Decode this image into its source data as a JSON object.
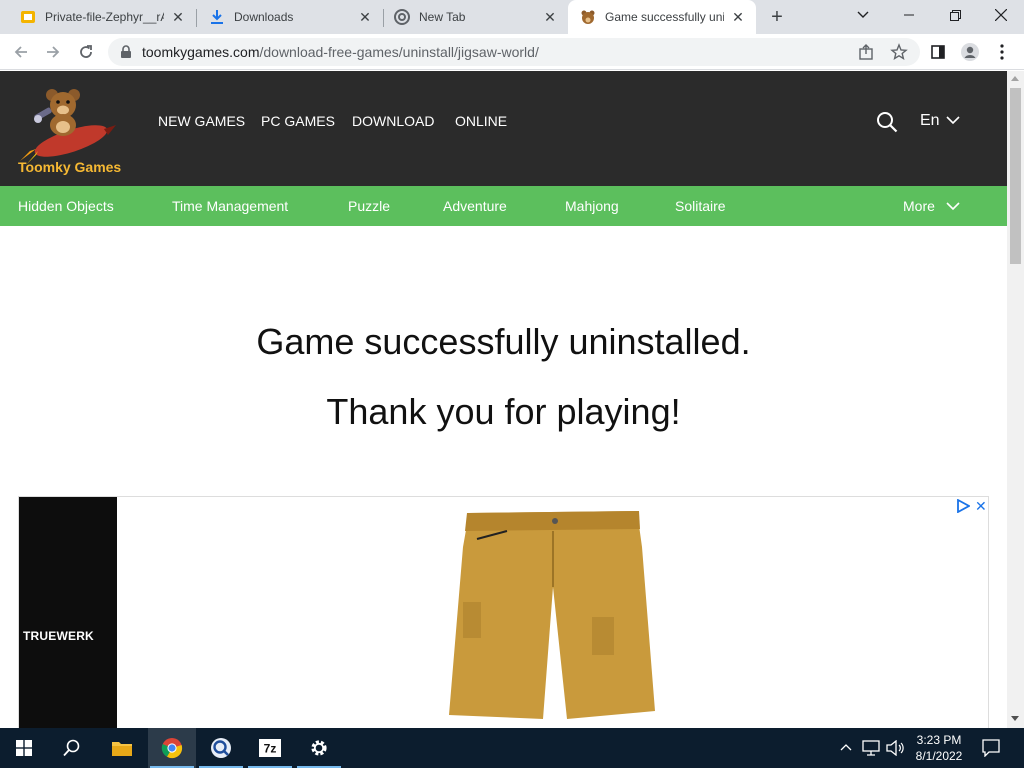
{
  "browser": {
    "tabs": [
      {
        "title": "Private-file-Zephyr__rA",
        "active": false
      },
      {
        "title": "Downloads",
        "active": false
      },
      {
        "title": "New Tab",
        "active": false
      },
      {
        "title": "Game successfully unin",
        "active": true
      }
    ],
    "url_domain": "toomkygames.com",
    "url_path": "/download-free-games/uninstall/jigsaw-world/"
  },
  "site": {
    "logo_text": "Toomky Games",
    "main_nav": [
      "NEW GAMES",
      "PC GAMES",
      "DOWNLOAD",
      "ONLINE"
    ],
    "language": "En",
    "categories": [
      "Hidden Objects",
      "Time Management",
      "Puzzle",
      "Adventure",
      "Mahjong",
      "Solitaire"
    ],
    "more_label": "More"
  },
  "content": {
    "message_line1": "Game successfully uninstalled.",
    "message_line2": "Thank you for playing!"
  },
  "ad": {
    "brand": "TRUEWERK",
    "close_label": "✕"
  },
  "taskbar": {
    "time": "3:23 PM",
    "date": "8/1/2022"
  },
  "colors": {
    "header_bg": "#2b2b2b",
    "category_bar": "#5cbf5d",
    "logo_text": "#f5b833",
    "taskbar_bg": "#0c1d2e"
  }
}
